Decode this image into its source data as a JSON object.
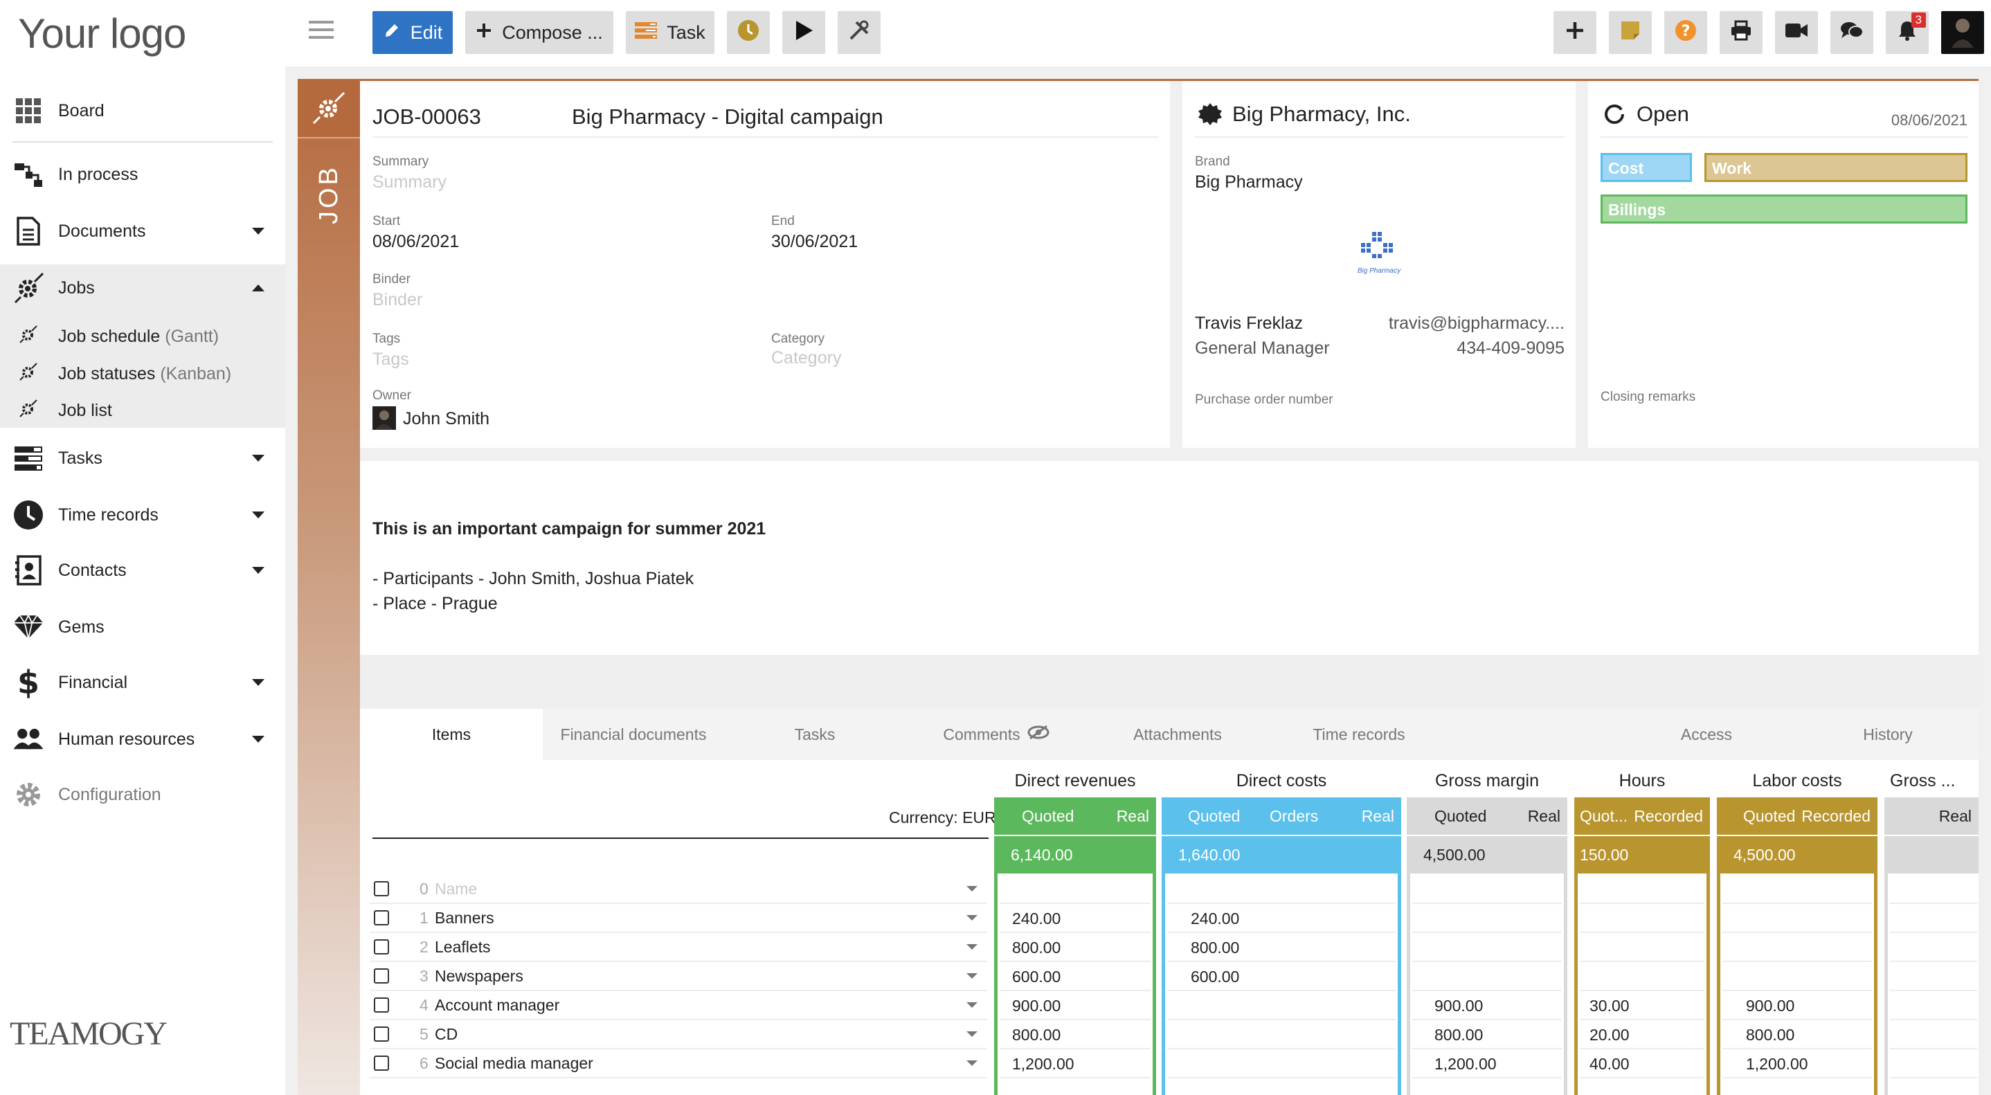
{
  "sidebar": {
    "logo": "Your logo",
    "items": [
      {
        "label": "Board"
      },
      {
        "label": "In process"
      },
      {
        "label": "Documents"
      },
      {
        "label": "Jobs"
      },
      {
        "label": "Tasks"
      },
      {
        "label": "Time records"
      },
      {
        "label": "Contacts"
      },
      {
        "label": "Gems"
      },
      {
        "label": "Financial"
      },
      {
        "label": "Human resources"
      },
      {
        "label": "Configuration"
      }
    ],
    "jobs_sub": [
      {
        "label": "Job schedule",
        "hint": "(Gantt)"
      },
      {
        "label": "Job statuses",
        "hint": "(Kanban)"
      },
      {
        "label": "Job list",
        "hint": ""
      }
    ],
    "bottom_logo": "TEAMOGY"
  },
  "toolbar": {
    "edit": "Edit",
    "compose": "Compose ...",
    "task": "Task",
    "notification_count": "3"
  },
  "job": {
    "strip_label": "JOB",
    "number": "JOB-00063",
    "title": "Big Pharmacy - Digital campaign",
    "summary_label": "Summary",
    "summary_placeholder": "Summary",
    "start_label": "Start",
    "start": "08/06/2021",
    "end_label": "End",
    "end": "30/06/2021",
    "binder_label": "Binder",
    "binder_placeholder": "Binder",
    "tags_label": "Tags",
    "tags_placeholder": "Tags",
    "category_label": "Category",
    "category_placeholder": "Category",
    "owner_label": "Owner",
    "owner": "John Smith"
  },
  "client": {
    "name": "Big Pharmacy, Inc.",
    "brand_label": "Brand",
    "brand": "Big Pharmacy",
    "brand_logo_text": "Big Pharmacy",
    "contact_name": "Travis Freklaz",
    "contact_role": "General Manager",
    "contact_email": "travis@bigpharmacy....",
    "contact_phone": "434-409-9095",
    "po_label": "Purchase order number"
  },
  "status": {
    "label": "Open",
    "date": "08/06/2021",
    "cost": "Cost",
    "work": "Work",
    "billings": "Billings",
    "closing_label": "Closing remarks"
  },
  "description": {
    "heading": "This is an important campaign for summer 2021",
    "line1": "- Participants - John Smith, Joshua Piatek",
    "line2": "- Place - Prague"
  },
  "tabs": [
    "Items",
    "Financial documents",
    "Tasks",
    "Comments",
    "Attachments",
    "Time records",
    "Access",
    "History"
  ],
  "table": {
    "currency": "Currency: EUR",
    "groups": {
      "direct_revenues": "Direct revenues",
      "direct_costs": "Direct costs",
      "gross_margin": "Gross margin",
      "hours": "Hours",
      "labor_costs": "Labor costs",
      "gross_trunc": "Gross ..."
    },
    "cols": {
      "quoted": "Quoted",
      "real": "Real",
      "orders": "Orders",
      "quot_trunc": "Quot...",
      "recorded": "Recorded"
    },
    "totals": {
      "dr_quoted": "6,140.00",
      "dc_quoted": "1,640.00",
      "gm_quoted": "4,500.00",
      "hours_quoted": "150.00",
      "labor_quoted": "4,500.00"
    },
    "name_placeholder": "Name",
    "rows": [
      {
        "num": "0",
        "name": "",
        "dr": "",
        "dc": "",
        "gm": "",
        "hrs": "",
        "lab": ""
      },
      {
        "num": "1",
        "name": "Banners",
        "dr": "240.00",
        "dc": "240.00",
        "gm": "",
        "hrs": "",
        "lab": ""
      },
      {
        "num": "2",
        "name": "Leaflets",
        "dr": "800.00",
        "dc": "800.00",
        "gm": "",
        "hrs": "",
        "lab": ""
      },
      {
        "num": "3",
        "name": "Newspapers",
        "dr": "600.00",
        "dc": "600.00",
        "gm": "",
        "hrs": "",
        "lab": ""
      },
      {
        "num": "4",
        "name": "Account manager",
        "dr": "900.00",
        "dc": "",
        "gm": "900.00",
        "hrs": "30.00",
        "lab": "900.00"
      },
      {
        "num": "5",
        "name": "CD",
        "dr": "800.00",
        "dc": "",
        "gm": "800.00",
        "hrs": "20.00",
        "lab": "800.00"
      },
      {
        "num": "6",
        "name": "Social media manager",
        "dr": "1,200.00",
        "dc": "",
        "gm": "1,200.00",
        "hrs": "40.00",
        "lab": "1,200.00"
      }
    ]
  },
  "colors": {
    "green": "#5cb85c",
    "blue": "#5bc0eb",
    "gold": "#b8952e",
    "grey": "#d9d9d9",
    "edit": "#2f73c5",
    "job": "#b56a3e"
  }
}
